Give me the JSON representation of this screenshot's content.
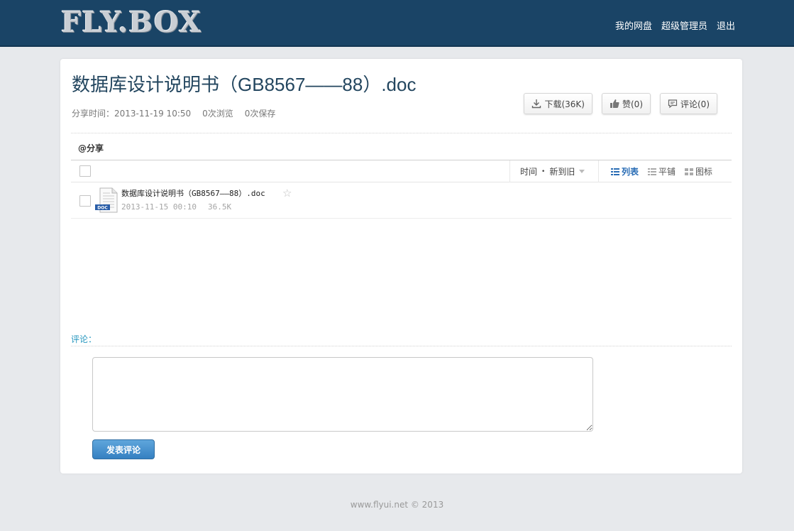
{
  "header": {
    "logo": "FLY.BOX",
    "nav": [
      "我的网盘",
      "超级管理员",
      "退出"
    ]
  },
  "doc": {
    "title": "数据库设计说明书（GB8567——88）.doc",
    "share_time": "分享时间：2013-11-19 10:50",
    "views": "0次浏览",
    "saves": "0次保存"
  },
  "actions": {
    "download": "下载(36K)",
    "like": "赞(0)",
    "comment": "评论(0)"
  },
  "share_label": "@分享",
  "toolbar": {
    "sort_time": "时间",
    "sort_dot": "•",
    "sort_order": "新到旧",
    "views": [
      "列表",
      "平铺",
      "图标"
    ]
  },
  "file": {
    "name": "数据库设计说明书（GB8567——88）.doc",
    "date": "2013-11-15 00:10",
    "size": "36.5K",
    "icon_label": "DOC"
  },
  "comment": {
    "label": "评论：",
    "textarea_value": "",
    "submit": "发表评论"
  },
  "footer": "www.flyui.net © 2013",
  "colors": {
    "topbar": "#1a4466",
    "accent": "#2596be",
    "button_blue": "#3580c1"
  }
}
